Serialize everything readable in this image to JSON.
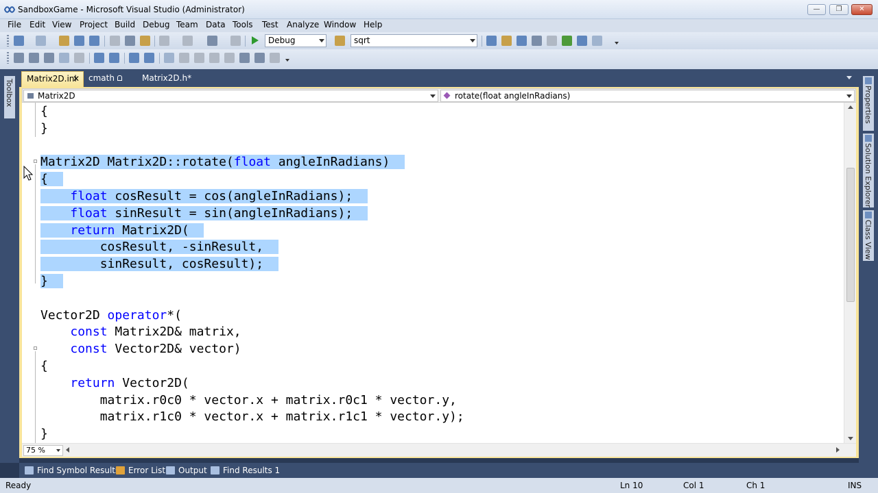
{
  "window": {
    "title": "SandboxGame - Microsoft Visual Studio (Administrator)"
  },
  "menu": [
    "File",
    "Edit",
    "View",
    "Project",
    "Build",
    "Debug",
    "Team",
    "Data",
    "Tools",
    "Test",
    "Analyze",
    "Window",
    "Help"
  ],
  "toolbar": {
    "configuration": "Debug",
    "find_value": "sqrt"
  },
  "doc_tabs": [
    {
      "label": "Matrix2D.inl",
      "active": true
    },
    {
      "label": "cmath",
      "active": false
    },
    {
      "label": "Matrix2D.h*",
      "active": false
    }
  ],
  "side_panels": {
    "left": "Toolbox",
    "right": [
      "Properties",
      "Solution Explorer",
      "Class View"
    ]
  },
  "navbar": {
    "scope": "Matrix2D",
    "member": "rotate(float angleInRadians)"
  },
  "code_lines": [
    {
      "parts": [
        {
          "t": "{"
        }
      ]
    },
    {
      "parts": [
        {
          "t": "}"
        }
      ]
    },
    {
      "parts": [
        {
          "t": ""
        }
      ]
    },
    {
      "parts": [
        {
          "t": "Matrix2D Matrix2D::rotate("
        },
        {
          "t": "float",
          "kw": true
        },
        {
          "t": " angleInRadians)"
        }
      ],
      "sel": true
    },
    {
      "parts": [
        {
          "t": "{"
        }
      ],
      "sel": true
    },
    {
      "parts": [
        {
          "t": "    "
        },
        {
          "t": "float",
          "kw": true
        },
        {
          "t": " cosResult = cos(angleInRadians);"
        }
      ],
      "sel": true
    },
    {
      "parts": [
        {
          "t": "    "
        },
        {
          "t": "float",
          "kw": true
        },
        {
          "t": " sinResult = sin(angleInRadians);"
        }
      ],
      "sel": true
    },
    {
      "parts": [
        {
          "t": "    "
        },
        {
          "t": "return",
          "kw": true
        },
        {
          "t": " Matrix2D("
        }
      ],
      "sel": true
    },
    {
      "parts": [
        {
          "t": "        cosResult, -sinResult,"
        }
      ],
      "sel": true
    },
    {
      "parts": [
        {
          "t": "        sinResult, cosResult);"
        }
      ],
      "sel": true
    },
    {
      "parts": [
        {
          "t": "}"
        }
      ],
      "sel": true
    },
    {
      "parts": [
        {
          "t": ""
        }
      ]
    },
    {
      "parts": [
        {
          "t": "Vector2D "
        },
        {
          "t": "operator",
          "kw": true
        },
        {
          "t": "*("
        }
      ]
    },
    {
      "parts": [
        {
          "t": "    "
        },
        {
          "t": "const",
          "kw": true
        },
        {
          "t": " Matrix2D& matrix,"
        }
      ]
    },
    {
      "parts": [
        {
          "t": "    "
        },
        {
          "t": "const",
          "kw": true
        },
        {
          "t": " Vector2D& vector)"
        }
      ]
    },
    {
      "parts": [
        {
          "t": "{"
        }
      ]
    },
    {
      "parts": [
        {
          "t": "    "
        },
        {
          "t": "return",
          "kw": true
        },
        {
          "t": " Vector2D("
        }
      ]
    },
    {
      "parts": [
        {
          "t": "        matrix.r0c0 * vector.x + matrix.r0c1 * vector.y,"
        }
      ]
    },
    {
      "parts": [
        {
          "t": "        matrix.r1c0 * vector.x + matrix.r1c1 * vector.y);"
        }
      ]
    },
    {
      "parts": [
        {
          "t": "}"
        }
      ]
    }
  ],
  "zoom": "75 %",
  "bottom_tabs": [
    "Find Symbol Results",
    "Error List",
    "Output",
    "Find Results 1"
  ],
  "status": {
    "message": "Ready",
    "line": "Ln 10",
    "col": "Col 1",
    "ch": "Ch 1",
    "mode": "INS"
  },
  "colors": {
    "keyword": "#0000ff",
    "selection": "#add6ff",
    "chrome": "#293955",
    "active_tab": "#f8e49a"
  }
}
